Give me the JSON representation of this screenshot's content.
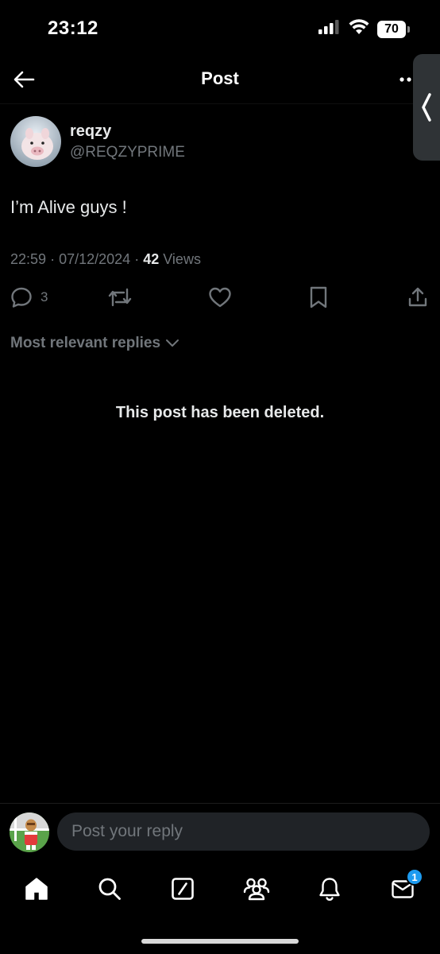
{
  "status_bar": {
    "time": "23:12",
    "battery_level": "70",
    "icons": [
      "signal-icon",
      "wifi-icon",
      "battery-icon"
    ]
  },
  "header": {
    "title": "Post",
    "back_icon": "arrow-left-icon",
    "more_icon": "more-dots-icon",
    "side_tab_icon": "chevron-left-icon"
  },
  "post": {
    "display_name": "reqzy",
    "handle": "@REQZYPRIME",
    "text": "I’m Alive guys !",
    "time": "22:59",
    "date": "07/12/2024",
    "separator": "·",
    "views_count": "42",
    "views_label": "Views"
  },
  "actions": {
    "reply_count": "3",
    "icons": [
      "reply-icon",
      "repost-icon",
      "like-icon",
      "bookmark-icon",
      "share-icon"
    ]
  },
  "replies": {
    "sort_label": "Most relevant replies",
    "deleted_message": "This post has been deleted."
  },
  "reply_bar": {
    "placeholder": "Post your reply"
  },
  "tabbar": {
    "items": [
      "home-icon",
      "search-icon",
      "grok-icon",
      "communities-icon",
      "notifications-icon",
      "messages-icon"
    ],
    "messages_badge": "1"
  },
  "colors": {
    "background": "#000000",
    "text_primary": "#e7e9ea",
    "text_secondary": "#71767b",
    "accent": "#1d9bf0"
  }
}
